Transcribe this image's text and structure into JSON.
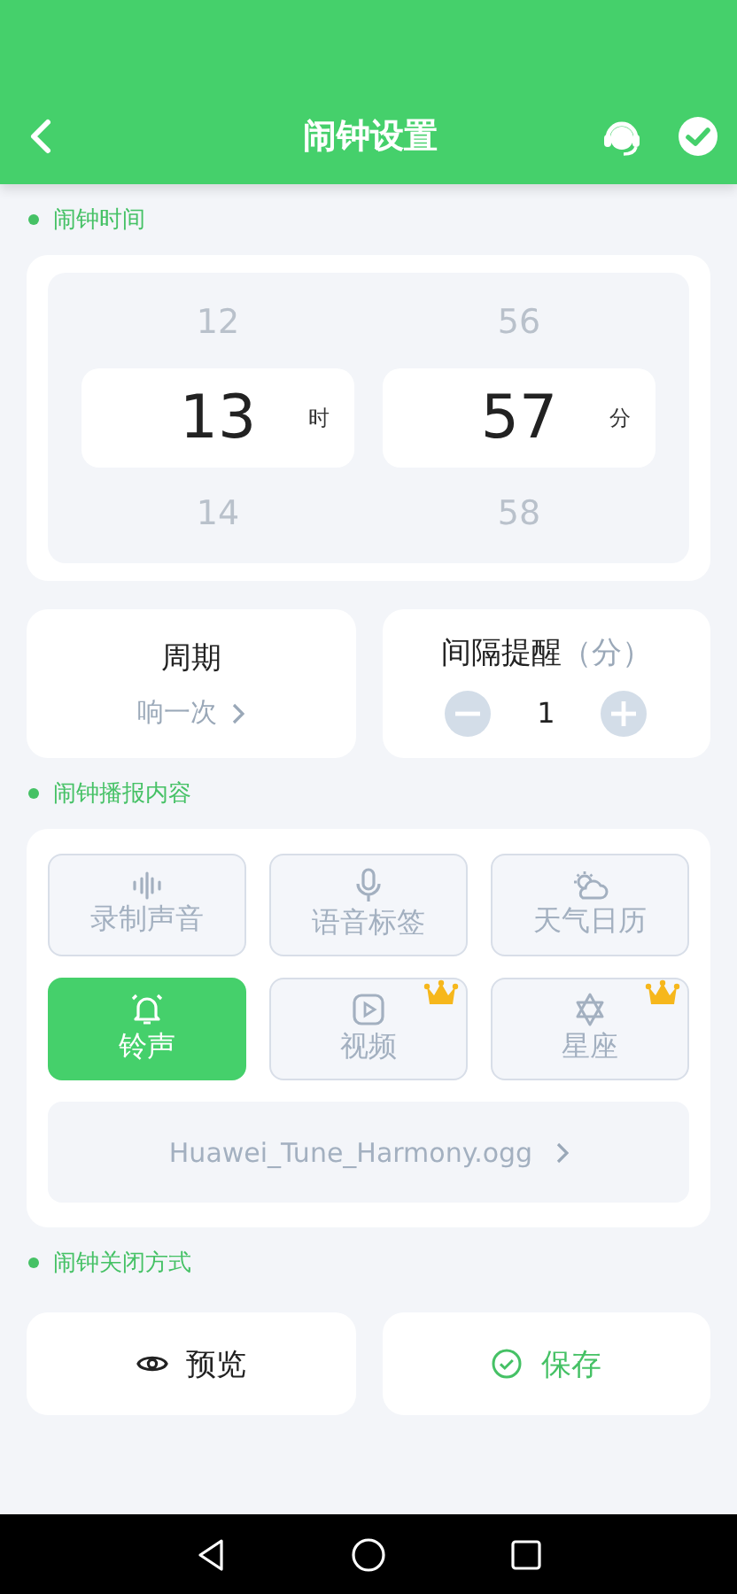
{
  "header": {
    "title": "闹钟设置"
  },
  "time_section": {
    "label": "闹钟时间"
  },
  "picker": [
    {
      "above": "12",
      "value": "13",
      "unit": "时",
      "below": "14"
    },
    {
      "above": "56",
      "value": "57",
      "unit": "分",
      "below": "58"
    }
  ],
  "cycle": {
    "title": "周期",
    "value": "响一次"
  },
  "interval": {
    "title": "间隔提醒",
    "unit": "（分）",
    "value": "1"
  },
  "content_section": {
    "label": "闹钟播报内容"
  },
  "content_types": [
    {
      "kind": "record",
      "label": "录制声音",
      "selected": false,
      "premium": false
    },
    {
      "kind": "voice",
      "label": "语音标签",
      "selected": false,
      "premium": false
    },
    {
      "kind": "weather",
      "label": "天气日历",
      "selected": false,
      "premium": false
    },
    {
      "kind": "ring",
      "label": "铃声",
      "selected": true,
      "premium": false
    },
    {
      "kind": "video",
      "label": "视频",
      "selected": false,
      "premium": true
    },
    {
      "kind": "star",
      "label": "星座",
      "selected": false,
      "premium": true
    }
  ],
  "ringtone": "Huawei_Tune_Harmony.ogg",
  "close_section": {
    "label": "闹钟关闭方式"
  },
  "buttons": [
    {
      "kind": "preview",
      "label": "预览"
    },
    {
      "kind": "save",
      "label": "保存"
    }
  ]
}
